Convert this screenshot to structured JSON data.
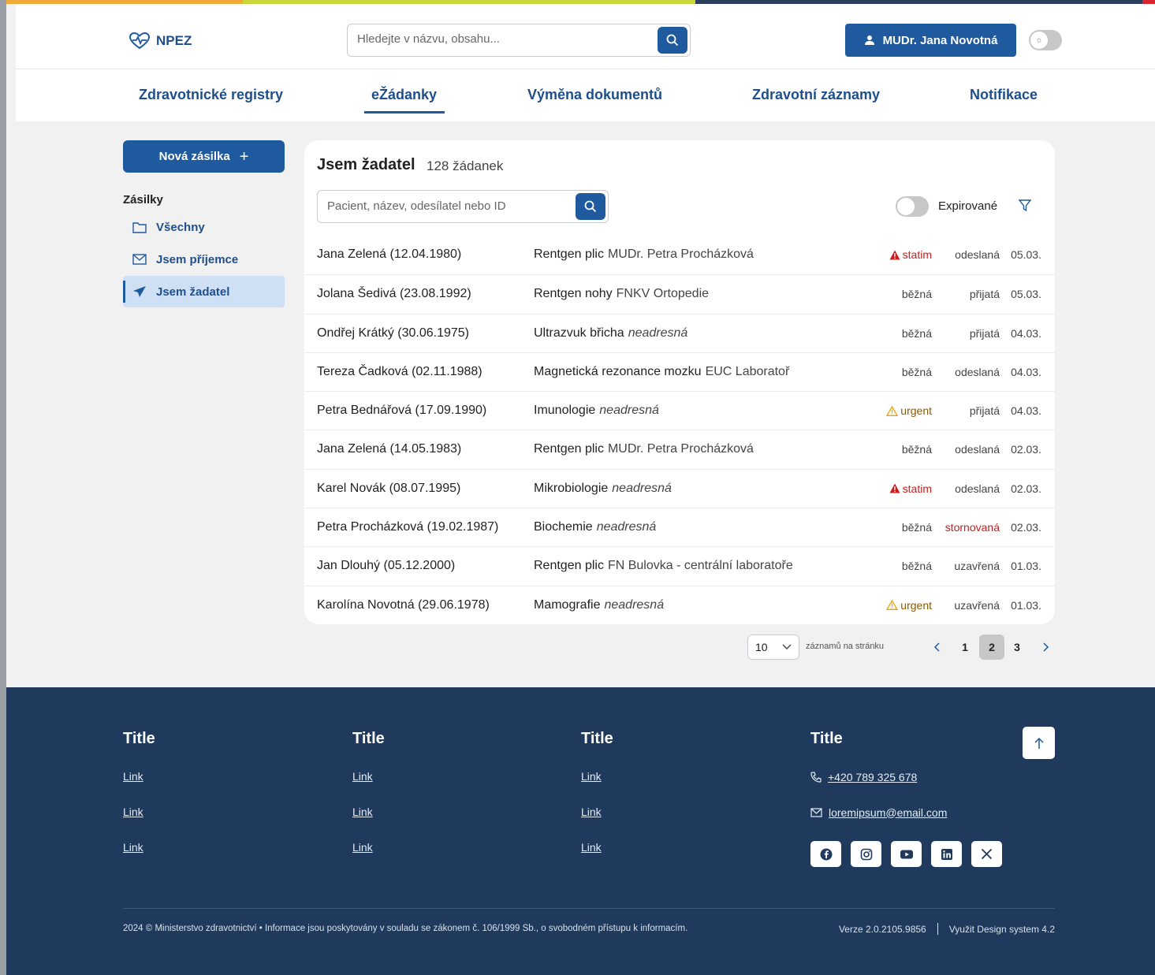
{
  "colors": {
    "primary": "#1f5a9e",
    "footer_bg": "#1f3a5c",
    "statim": "#c81e1e",
    "storno": "#c81e1e",
    "urgent_icon": "#e8a300",
    "topbar": [
      "#f2a93b",
      "#c9d63a",
      "#2b3f5c",
      "#d9262e"
    ]
  },
  "header": {
    "logo_text": "NPEZ",
    "logo_icon": "heart-pulse-icon",
    "search_placeholder": "Hledejte v názvu, obsahu...",
    "user_name": "MUDr. Jana Novotná"
  },
  "tabs": [
    {
      "label": "Zdravotnické registry",
      "active": false
    },
    {
      "label": "eŽádanky",
      "active": true
    },
    {
      "label": "Výměna dokumentů",
      "active": false
    },
    {
      "label": "Zdravotní záznamy",
      "active": false
    },
    {
      "label": "Notifikace",
      "active": false
    }
  ],
  "sidebar": {
    "new_button": "Nová zásilka",
    "heading": "Zásilky",
    "items": [
      {
        "label": "Všechny",
        "icon": "folder-icon",
        "active": false
      },
      {
        "label": "Jsem příjemce",
        "icon": "envelope-icon",
        "active": false
      },
      {
        "label": "Jsem žadatel",
        "icon": "send-icon",
        "active": true
      }
    ]
  },
  "main": {
    "title": "Jsem žadatel",
    "count": "128 žádanek",
    "search_placeholder": "Pacient, název, odesílatel nebo ID",
    "expired_label": "Expirované",
    "rows": [
      {
        "patient": "Jana Zelená (12.04.1980)",
        "exam": "Rentgen plic",
        "sender": "MUDr. Petra Procházková",
        "sender_italic": false,
        "priority": "statim",
        "state": "odeslaná",
        "date": "05.03."
      },
      {
        "patient": "Jolana Šedivá (23.08.1992)",
        "exam": "Rentgen nohy",
        "sender": "FNKV Ortopedie",
        "sender_italic": false,
        "priority": "běžná",
        "state": "přijatá",
        "date": "05.03."
      },
      {
        "patient": "Ondřej Krátký (30.06.1975)",
        "exam": "Ultrazvuk břicha",
        "sender": "neadresná",
        "sender_italic": true,
        "priority": "běžná",
        "state": "přijatá",
        "date": "04.03."
      },
      {
        "patient": "Tereza Čadková (02.11.1988)",
        "exam": "Magnetická rezonance mozku",
        "sender": "EUC Laboratoř",
        "sender_italic": false,
        "priority": "běžná",
        "state": "odeslaná",
        "date": "04.03."
      },
      {
        "patient": "Petra Bednářová (17.09.1990)",
        "exam": "Imunologie",
        "sender": "neadresná",
        "sender_italic": true,
        "priority": "urgent",
        "state": "přijatá",
        "date": "04.03."
      },
      {
        "patient": "Jana Zelená (14.05.1983)",
        "exam": "Rentgen plic",
        "sender": "MUDr. Petra Procházková",
        "sender_italic": false,
        "priority": "běžná",
        "state": "odeslaná",
        "date": "02.03."
      },
      {
        "patient": "Karel Novák (08.07.1995)",
        "exam": "Mikrobiologie",
        "sender": "neadresná",
        "sender_italic": true,
        "priority": "statim",
        "state": "odeslaná",
        "date": "02.03."
      },
      {
        "patient": "Petra Procházková (19.02.1987)",
        "exam": "Biochemie",
        "sender": "neadresná",
        "sender_italic": true,
        "priority": "běžná",
        "state": "stornovaná",
        "date": "02.03."
      },
      {
        "patient": "Jan Dlouhý (05.12.2000)",
        "exam": "Rentgen plic",
        "sender": "FN Bulovka - centrální laboratoře",
        "sender_italic": false,
        "priority": "běžná",
        "state": "uzavřená",
        "date": "01.03."
      },
      {
        "patient": "Karolína Novotná (29.06.1978)",
        "exam": "Mamografie",
        "sender": "neadresná",
        "sender_italic": true,
        "priority": "urgent",
        "state": "uzavřená",
        "date": "01.03."
      }
    ]
  },
  "pagination": {
    "per_page": "10",
    "per_page_label": "záznamů na stránku",
    "pages": [
      "1",
      "2",
      "3"
    ],
    "current": "2"
  },
  "footer": {
    "columns": [
      {
        "title": "Title",
        "links": [
          "Link",
          "Link",
          "Link"
        ]
      },
      {
        "title": "Title",
        "links": [
          "Link",
          "Link",
          "Link"
        ]
      },
      {
        "title": "Title",
        "links": [
          "Link",
          "Link",
          "Link"
        ]
      }
    ],
    "contact": {
      "title": "Title",
      "phone": "+420 789 325 678",
      "email": "loremipsum@email.com",
      "socials": [
        "facebook-icon",
        "instagram-icon",
        "youtube-icon",
        "linkedin-icon",
        "x-icon"
      ]
    },
    "copyright": "2024 © Ministerstvo zdravotnictví • Informace jsou poskytovány v souladu se zákonem č. 106/1999 Sb., o svobodném přístupu k informacím.",
    "version": "Verze 2.0.2105.9856",
    "design_system": "Využit Design system 4.2"
  }
}
